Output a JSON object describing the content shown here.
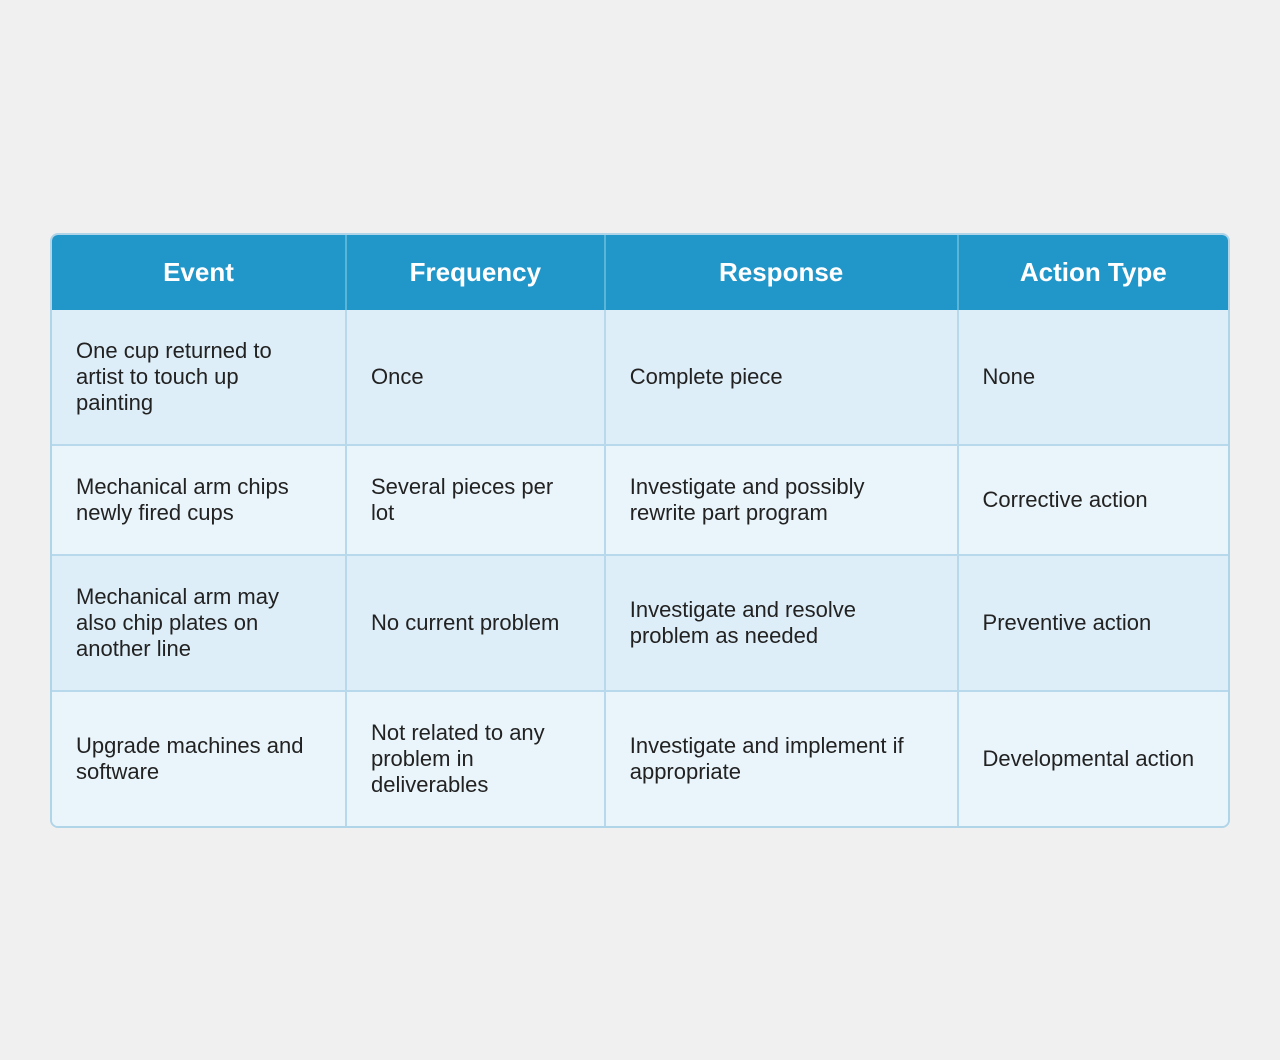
{
  "table": {
    "headers": {
      "event": "Event",
      "frequency": "Frequency",
      "response": "Response",
      "action_type": "Action Type"
    },
    "rows": [
      {
        "event": "One cup returned to artist to touch up painting",
        "frequency": "Once",
        "response": "Complete piece",
        "action_type": "None"
      },
      {
        "event": "Mechanical arm chips newly fired cups",
        "frequency": "Several pieces per lot",
        "response": "Investigate and possibly rewrite part program",
        "action_type": "Corrective action"
      },
      {
        "event": "Mechanical arm may also chip plates on another line",
        "frequency": "No current problem",
        "response": "Investigate and resolve problem as needed",
        "action_type": "Preventive action"
      },
      {
        "event": "Upgrade machines and software",
        "frequency": "Not related to any problem in deliverables",
        "response": "Investigate and implement if appropriate",
        "action_type": "Developmental action"
      }
    ]
  }
}
